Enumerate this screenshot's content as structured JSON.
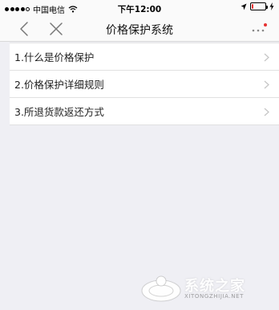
{
  "status_bar": {
    "carrier": "中国电信",
    "time": "下午12:00",
    "signal_bars": 4,
    "battery_level": 0.15,
    "battery_color": "#e63131",
    "icons": [
      "signal-dots-icon",
      "wifi-icon",
      "location-arrow-icon",
      "battery-icon",
      "charging-bolt-icon"
    ]
  },
  "nav": {
    "title": "价格保护系统",
    "back_icon": "chevron-left-icon",
    "close_icon": "close-icon",
    "more_icon": "more-dots-icon",
    "accent": "#e63131"
  },
  "list": {
    "items": [
      {
        "label": "1.什么是价格保护"
      },
      {
        "label": "2.价格保护详细规则"
      },
      {
        "label": "3.所退货款返还方式"
      }
    ],
    "chevron_icon": "chevron-right-icon"
  },
  "watermark": {
    "text": "系统之家",
    "sub": "XITONGZHIJIA.NET"
  }
}
